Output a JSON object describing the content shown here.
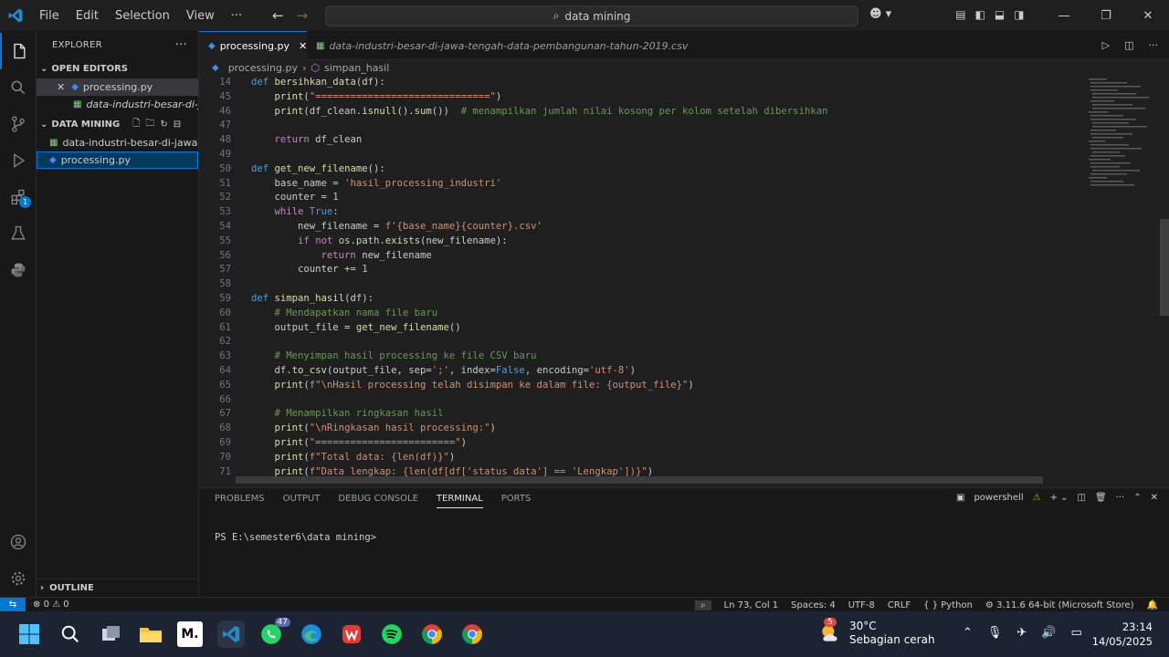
{
  "titlebar": {
    "menus": [
      "File",
      "Edit",
      "Selection",
      "View"
    ],
    "more": "···",
    "search": "data mining"
  },
  "sidebar": {
    "title": "EXPLORER",
    "open_editors_label": "OPEN EDITORS",
    "open_editors": [
      "processing.py",
      "data-industri-besar-di-ja..."
    ],
    "folder_label": "DATA MINING",
    "files": [
      "data-industri-besar-di-jawa-t...",
      "processing.py"
    ],
    "outline_label": "OUTLINE",
    "extensions_badge": "1"
  },
  "tabs": [
    {
      "label": "processing.py",
      "active": true
    },
    {
      "label": "data-industri-besar-di-jawa-tengah-data-pembangunan-tahun-2019.csv",
      "active": false
    }
  ],
  "breadcrumb": [
    "processing.py",
    "simpan_hasil"
  ],
  "editor": {
    "lines": [
      {
        "n": "14",
        "text": "def bersihkan_data(df):"
      },
      {
        "n": "45",
        "text": "    print(\"==============================\")"
      },
      {
        "n": "46",
        "text": "    print(df_clean.isnull().sum())  # menampilkan jumlah nilai kosong per kolom setelah dibersihkan"
      },
      {
        "n": "47",
        "text": ""
      },
      {
        "n": "48",
        "text": "    return df_clean"
      },
      {
        "n": "49",
        "text": ""
      },
      {
        "n": "50",
        "text": "def get_new_filename():"
      },
      {
        "n": "51",
        "text": "    base_name = 'hasil_processing_industri'"
      },
      {
        "n": "52",
        "text": "    counter = 1"
      },
      {
        "n": "53",
        "text": "    while True:"
      },
      {
        "n": "54",
        "text": "        new_filename = f'{base_name}{counter}.csv'"
      },
      {
        "n": "55",
        "text": "        if not os.path.exists(new_filename):"
      },
      {
        "n": "56",
        "text": "            return new_filename"
      },
      {
        "n": "57",
        "text": "        counter += 1"
      },
      {
        "n": "58",
        "text": ""
      },
      {
        "n": "59",
        "text": "def simpan_hasil(df):"
      },
      {
        "n": "60",
        "text": "    # Mendapatkan nama file baru"
      },
      {
        "n": "61",
        "text": "    output_file = get_new_filename()"
      },
      {
        "n": "62",
        "text": ""
      },
      {
        "n": "63",
        "text": "    # Menyimpan hasil processing ke file CSV baru"
      },
      {
        "n": "64",
        "text": "    df.to_csv(output_file, sep=';', index=False, encoding='utf-8')"
      },
      {
        "n": "65",
        "text": "    print(f\"\\nHasil processing telah disimpan ke dalam file: {output_file}\")"
      },
      {
        "n": "66",
        "text": ""
      },
      {
        "n": "67",
        "text": "    # Menampilkan ringkasan hasil"
      },
      {
        "n": "68",
        "text": "    print(\"\\nRingkasan hasil processing:\")"
      },
      {
        "n": "69",
        "text": "    print(\"========================\")"
      },
      {
        "n": "70",
        "text": "    print(f\"Total data: {len(df)}\")"
      },
      {
        "n": "71",
        "text": "    print(f\"Data lengkap: {len(df[df['status_data'] == 'Lengkap'])}\")"
      }
    ]
  },
  "panel": {
    "tabs": [
      "PROBLEMS",
      "OUTPUT",
      "DEBUG CONSOLE",
      "TERMINAL",
      "PORTS"
    ],
    "active_tab": "TERMINAL",
    "shell": "powershell",
    "prompt": "PS E:\\semester6\\data mining>"
  },
  "statusbar": {
    "problems": "0",
    "warnings": "0",
    "position": "Ln 73, Col 1",
    "spaces": "Spaces: 4",
    "encoding": "UTF-8",
    "eol": "CRLF",
    "language": "Python",
    "interpreter": "3.11.6 64-bit (Microsoft Store)"
  },
  "taskbar": {
    "whatsapp_badge": "47",
    "weather_badge": "5",
    "temperature": "30°C",
    "weather": "Sebagian cerah",
    "time": "23:14",
    "date": "14/05/2025"
  }
}
